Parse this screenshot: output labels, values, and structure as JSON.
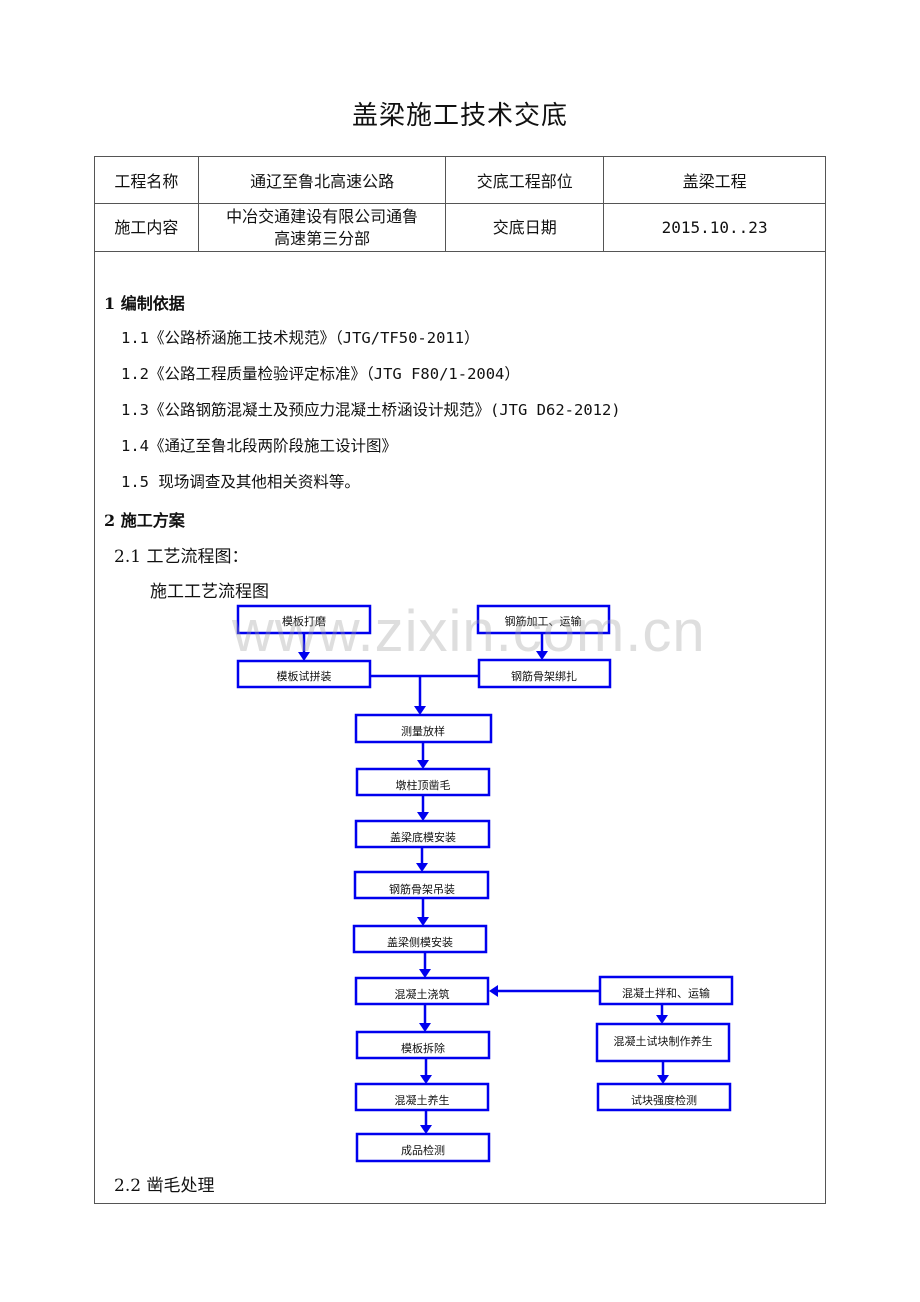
{
  "document": {
    "title": "盖梁施工技术交底",
    "info_table": {
      "project_name_label": "工程名称",
      "project_name_value": "通辽至鲁北高速公路",
      "part_label": "交底工程部位",
      "part_value": "盖梁工程",
      "content_label": "施工内容",
      "content_value_line1": "中冶交通建设有限公司通鲁",
      "content_value_line2": "高速第三分部",
      "date_label": "交底日期",
      "date_value": "2015.10..23"
    },
    "section1": {
      "heading": "1 编制依据",
      "items": [
        "1.1《公路桥涵施工技术规范》（JTG/TF50-2011）",
        "1.2《公路工程质量检验评定标准》（JTG F80/1-2004）",
        "1.3《公路钢筋混凝土及预应力混凝土桥涵设计规范》(JTG D62-2012)",
        "1.4《通辽至鲁北段两阶段施工设计图》",
        "1.5 现场调查及其他相关资料等。"
      ]
    },
    "section2": {
      "heading": "2 施工方案",
      "sub1": "2.1 工艺流程图：",
      "flowchart_title": "施工工艺流程图",
      "sub2": "2.2 凿毛处理"
    },
    "flowchart": {
      "steps": [
        "模板打磨",
        "钢筋加工、运输",
        "模板试拼装",
        "钢筋骨架绑扎",
        "测量放样",
        "墩柱顶凿毛",
        "盖梁底模安装",
        "钢筋骨架吊装",
        "盖梁侧模安装",
        "混凝土浇筑",
        "混凝土拌和、运输",
        "模板拆除",
        "混凝土试块制作养生",
        "混凝土养生",
        "试块强度检测",
        "成品检测"
      ],
      "line_color": "#0000ee"
    },
    "watermark": "www.zixin.com.cn"
  }
}
